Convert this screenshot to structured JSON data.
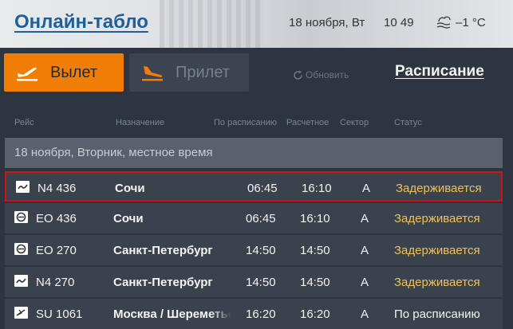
{
  "header": {
    "title": "Онлайн-табло",
    "date": "18 ноября, Вт",
    "time": "10 49",
    "temperature": "–1 °C",
    "weather_icon": "fog-icon"
  },
  "tabs": {
    "departures": "Вылет",
    "arrivals": "Прилет",
    "refresh": "Обновить",
    "schedule": "Расписание",
    "active": "departures",
    "accent": "#f07d06"
  },
  "columns": [
    "Рейс",
    "Назначение",
    "По расписанию",
    "Расчетное",
    "Сектор",
    "Статус"
  ],
  "date_band": "18 ноября, Вторник, местное время",
  "rows": [
    {
      "flight": "N4 436",
      "dest": "Сочи",
      "sched": "06:45",
      "est": "16:10",
      "sector": "A",
      "status": "Задерживается",
      "status_type": "delayed",
      "highlight": true,
      "logo": "nordwind-logo"
    },
    {
      "flight": "EO 436",
      "dest": "Сочи",
      "sched": "06:45",
      "est": "16:10",
      "sector": "A",
      "status": "Задерживается",
      "status_type": "delayed",
      "highlight": false,
      "logo": "ikar-logo"
    },
    {
      "flight": "EO 270",
      "dest": "Санкт-Петербург",
      "sched": "14:50",
      "est": "14:50",
      "sector": "A",
      "status": "Задерживается",
      "status_type": "delayed",
      "highlight": false,
      "logo": "ikar-logo"
    },
    {
      "flight": "N4 270",
      "dest": "Санкт-Петербург",
      "sched": "14:50",
      "est": "14:50",
      "sector": "A",
      "status": "Задерживается",
      "status_type": "delayed",
      "highlight": false,
      "logo": "nordwind-logo"
    },
    {
      "flight": "SU 1061",
      "dest": "Москва / Шереметьево",
      "sched": "16:20",
      "est": "16:20",
      "sector": "A",
      "status": "По расписанию",
      "status_type": "ontime",
      "highlight": false,
      "logo": "aeroflot-logo"
    }
  ]
}
